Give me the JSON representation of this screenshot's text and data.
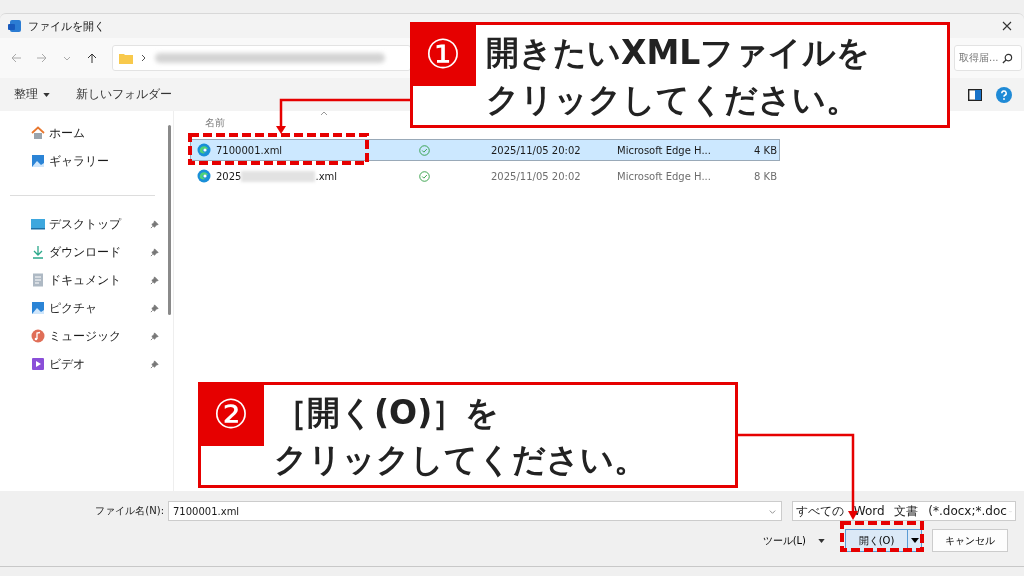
{
  "window": {
    "title": "ファイルを開く"
  },
  "search": {
    "value": "取得届..."
  },
  "toolbar": {
    "organize": "整理",
    "new_folder": "新しいフォルダー"
  },
  "sidebar": {
    "top": [
      {
        "label": "ホーム",
        "kind": "home"
      },
      {
        "label": "ギャラリー",
        "kind": "gallery"
      }
    ],
    "pinned": [
      {
        "label": "デスクトップ",
        "kind": "desktop",
        "pinned": true
      },
      {
        "label": "ダウンロード",
        "kind": "download",
        "pinned": true
      },
      {
        "label": "ドキュメント",
        "kind": "document",
        "pinned": true
      },
      {
        "label": "ピクチャ",
        "kind": "picture",
        "pinned": true
      },
      {
        "label": "ミュージック",
        "kind": "music",
        "pinned": true
      },
      {
        "label": "ビデオ",
        "kind": "video",
        "pinned": true
      }
    ]
  },
  "file_list": {
    "columns": [
      "名前"
    ],
    "rows": [
      {
        "name": [
          "7100001.xml"
        ],
        "synced": true,
        "modified": "2025/11/05 20:02",
        "type": "Microsoft Edge H...",
        "size": "4 KB",
        "selected": true
      },
      {
        "name": [
          "2025",
          ".xml"
        ],
        "synced": true,
        "modified": "2025/11/05 20:02",
        "type": "Microsoft Edge H...",
        "size": "8 KB",
        "selected": false
      }
    ]
  },
  "footer": {
    "filename_label": "ファイル名(N):",
    "filename": "7100001.xml",
    "filetype": "すべての Word 文書 (*.docx;*.doc",
    "tools": "ツール(L)",
    "open": "開く(O)",
    "cancel": "キャンセル"
  },
  "callouts": [
    {
      "number": "①",
      "lines": [
        "開きたいXMLファイルを",
        "クリックしてください。"
      ]
    },
    {
      "number": "②",
      "lines": [
        "［開く(O)］を",
        "クリックしてください。"
      ]
    }
  ]
}
